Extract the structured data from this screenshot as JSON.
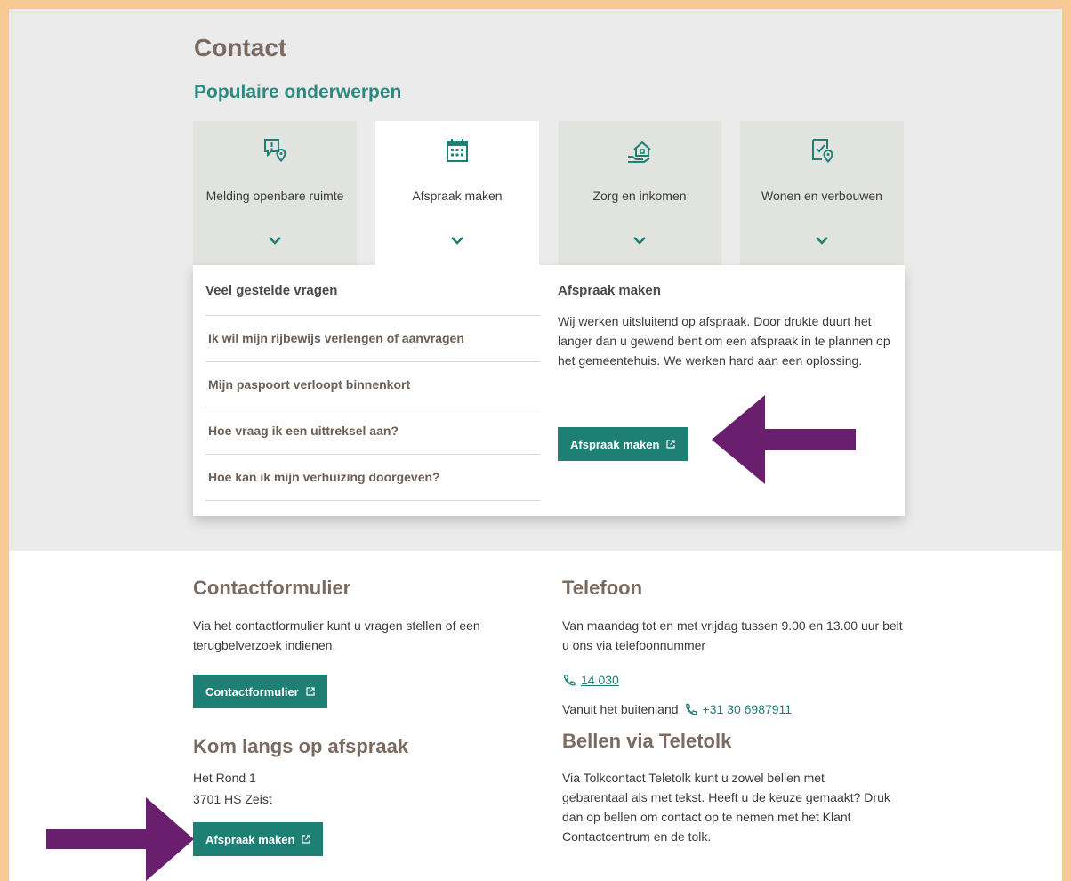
{
  "page": {
    "title": "Contact",
    "popular_heading": "Populaire onderwerpen"
  },
  "topics": [
    {
      "label": "Melding openbare ruimte",
      "icon": "report-location-icon"
    },
    {
      "label": "Afspraak maken",
      "icon": "calendar-icon"
    },
    {
      "label": "Zorg en inkomen",
      "icon": "house-hand-icon"
    },
    {
      "label": "Wonen en verbouwen",
      "icon": "document-check-location-icon"
    }
  ],
  "panel": {
    "faq_heading": "Veel gestelde vragen",
    "faq": [
      "Ik wil mijn rijbewijs verlengen of aanvragen",
      "Mijn paspoort verloopt binnenkort",
      "Hoe vraag ik een uittreksel aan?",
      "Hoe kan ik mijn verhuizing doorgeven?"
    ],
    "info_heading": "Afspraak maken",
    "info_text": "Wij werken uitsluitend op afspraak. Door drukte duurt het langer dan u gewend bent om een afspraak in te plannen op het gemeentehuis. We werken hard aan een oplossing.",
    "button_label": "Afspraak maken"
  },
  "contactform": {
    "heading": "Contactformulier",
    "text": "Via het contactformulier kunt u vragen stellen of een terugbelverzoek indienen.",
    "button_label": "Contactformulier"
  },
  "visit": {
    "heading": "Kom langs op afspraak",
    "address_line1": "Het Rond 1",
    "address_line2": "3701 HS Zeist",
    "button_label": "Afspraak maken"
  },
  "phone": {
    "heading": "Telefoon",
    "text": "Van maandag tot en met vrijdag tussen 9.00 en 13.00 uur belt u ons via telefoonnummer",
    "number": "14 030",
    "abroad_label": "Vanuit het buitenland",
    "abroad_number": "+31 30 6987911"
  },
  "teletolk": {
    "heading": "Bellen via Teletolk",
    "text": "Via Tolkcontact Teletolk kunt u zowel bellen met gebarentaal als met tekst. Heeft u de keuze gemaakt? Druk dan op bellen om contact op te nemen met het Klant Contactcentrum en de tolk."
  },
  "colors": {
    "accent": "#1e7f74",
    "heading": "#7a6a60",
    "annotation_arrow": "#6a1f6e",
    "frame": "#f7c994"
  }
}
